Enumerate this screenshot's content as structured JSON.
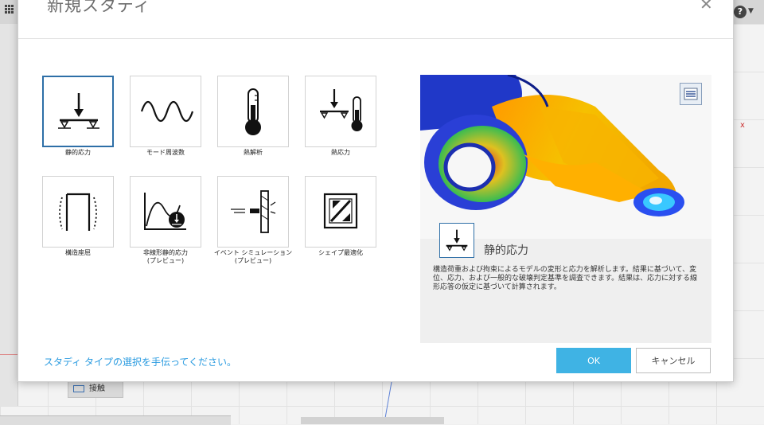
{
  "background": {
    "help_glyph": "?",
    "chip_label": "接触"
  },
  "dialog": {
    "title": "新規スタディ",
    "close_glyph": "✕",
    "tiles": [
      {
        "label": "静的応力",
        "icon": "static-stress-icon"
      },
      {
        "label": "モード周波数",
        "icon": "modal-frequency-icon"
      },
      {
        "label": "熱解析",
        "icon": "thermal-icon"
      },
      {
        "label": "熱応力",
        "icon": "thermal-stress-icon"
      },
      {
        "label": "構造座屈",
        "icon": "structural-buckling-icon"
      },
      {
        "label": "非線形静的応力\n(プレビュー)",
        "icon": "nonlinear-static-stress-icon"
      },
      {
        "label": "イベント シミュレーション\n(プレビュー)",
        "icon": "event-simulation-icon"
      },
      {
        "label": "シェイプ最適化",
        "icon": "shape-optimization-icon"
      }
    ],
    "preview": {
      "title": "静的応力",
      "description": "構造荷重および拘束によるモデルの変形と応力を解析します。結果に基づいて、変位、応力、および一般的な破壊判定基準を調査できます。結果は、応力に対する線形応答の仮定に基づいて計算されます。"
    },
    "help_link": "スタディ タイプの選択を手伝ってください。",
    "ok_label": "OK",
    "cancel_label": "キャンセル",
    "colors": {
      "accent": "#3fb3e4",
      "selected_border": "#2e6fa7",
      "link": "#2a9be0"
    }
  }
}
